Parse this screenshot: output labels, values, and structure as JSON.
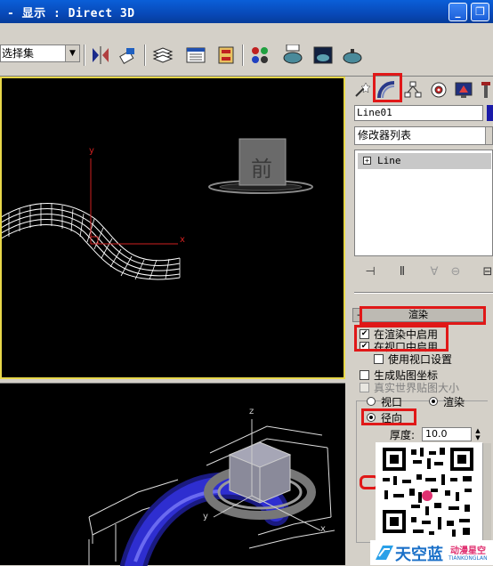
{
  "window": {
    "title": "- 显示 : Direct 3D",
    "min_label": "_",
    "restore_label": "❐"
  },
  "toolbar": {
    "selection_set": "选择集",
    "icons": [
      "mirror-icon",
      "align-icon",
      "layer-manager-icon",
      "track-view-icon",
      "schematic-view-icon",
      "material-editor-icon",
      "render-setup-icon",
      "render-frame-icon",
      "quick-render-icon"
    ]
  },
  "viewports": {
    "top": {
      "axis_y": "y",
      "axis_x": "x",
      "box_label": "前"
    },
    "perspective": {
      "axis_y": "y",
      "axis_x": "x",
      "axis_z": "z"
    }
  },
  "command_panel": {
    "tabs": [
      "create-tab",
      "modify-tab",
      "hierarchy-tab",
      "motion-tab",
      "display-tab",
      "utilities-tab"
    ],
    "object_name": "Line01",
    "object_color": "#1a1aa8",
    "modifier_list": "修改器列表",
    "stack_item": "Line",
    "rendering": {
      "header": "渲染",
      "collapse_label": "-",
      "enable_in_renderer": "在渲染中启用",
      "enable_in_viewport": "在视口中启用",
      "use_viewport_settings": "使用视口设置",
      "generate_mapping": "生成贴图坐标",
      "real_world_map_size": "真实世界贴图大小",
      "viewport_option": "视口",
      "renderer_option": "渲染",
      "radial": "径向",
      "thickness_label": "厚度:",
      "thickness_value": "10.0"
    }
  },
  "watermark": {
    "brand_cn": "天空蓝",
    "brand_tag": "动漫星空",
    "brand_sub": "TIANKONGLAN"
  },
  "colors": {
    "highlight": "#e01818",
    "titlebar": "#0849b8",
    "viewport_border_active": "#e8d84a",
    "tube": "#2828c8"
  }
}
